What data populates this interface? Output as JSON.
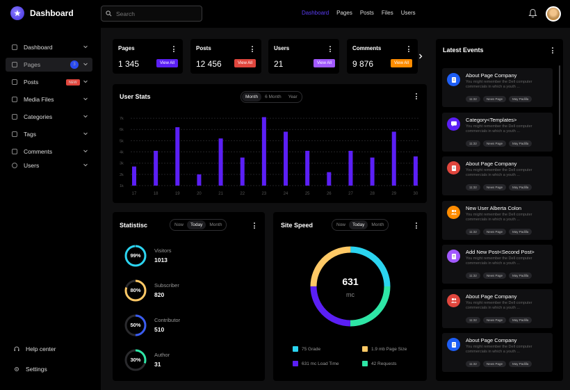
{
  "app": {
    "title": "Dashboard"
  },
  "search": {
    "placeholder": "Search"
  },
  "topnav": [
    {
      "label": "Dashboard",
      "active": true
    },
    {
      "label": "Pages"
    },
    {
      "label": "Posts"
    },
    {
      "label": "Files"
    },
    {
      "label": "Users"
    }
  ],
  "sidebar": {
    "items": [
      {
        "label": "Dashboard"
      },
      {
        "label": "Pages",
        "badge": "3"
      },
      {
        "label": "Posts",
        "badge": "NEW"
      },
      {
        "label": "Media Files"
      },
      {
        "label": "Categories"
      },
      {
        "label": "Tags"
      },
      {
        "label": "Comments"
      },
      {
        "label": "Users"
      }
    ],
    "help": "Help center",
    "settings": "Settings"
  },
  "stats": [
    {
      "label": "Pages",
      "value": "1 345",
      "button": "View All",
      "color": "#5b1ff5"
    },
    {
      "label": "Posts",
      "value": "12 456",
      "button": "View All",
      "color": "#e0463d"
    },
    {
      "label": "Users",
      "value": "21",
      "button": "View All",
      "color": "#a259ff"
    },
    {
      "label": "Comments",
      "value": "9 876",
      "button": "View All",
      "color": "#ff8c00"
    }
  ],
  "user_stats": {
    "title": "User Stats",
    "tabs": [
      "Month",
      "6 Month",
      "Year"
    ]
  },
  "chart_data": {
    "type": "bar",
    "categories": [
      "17",
      "18",
      "19",
      "20",
      "21",
      "22",
      "23",
      "24",
      "25",
      "26",
      "27",
      "28",
      "29",
      "30"
    ],
    "values": [
      2.7,
      4.1,
      6.2,
      2.0,
      5.2,
      3.5,
      7.1,
      5.8,
      4.1,
      2.2,
      4.1,
      3.5,
      5.8,
      3.6
    ],
    "y_ticks": [
      "1k",
      "2k",
      "3k",
      "4k",
      "5k",
      "6k",
      "7k"
    ],
    "ylim": [
      1,
      7.5
    ],
    "color": "#5b1ff5",
    "grid": true
  },
  "statistic": {
    "title": "Statistisc",
    "tabs": [
      "Now",
      "Today",
      "Month"
    ],
    "rows": [
      {
        "pct": "99%",
        "percent": 99,
        "name": "Visitors",
        "value": "1013",
        "color": "#2bd4f0"
      },
      {
        "pct": "80%",
        "percent": 80,
        "name": "Subscriber",
        "value": "820",
        "color": "#ffc966"
      },
      {
        "pct": "50%",
        "percent": 50,
        "name": "Contributor",
        "value": "510",
        "color": "#3a5cf0"
      },
      {
        "pct": "30%",
        "percent": 30,
        "name": "Author",
        "value": "31",
        "color": "#2ee6a6"
      }
    ]
  },
  "site_speed": {
    "title": "Site Speed",
    "tabs": [
      "Now",
      "Today",
      "Month"
    ],
    "value": "631",
    "unit": "mc",
    "legend": [
      {
        "label": "75 Grade",
        "color": "#2bd4f0"
      },
      {
        "label": "1.9 mb Page Size",
        "color": "#ffc966"
      },
      {
        "label": "631 mc Load Time",
        "color": "#5b1ff5"
      },
      {
        "label": "42 Requests",
        "color": "#2ee6a6"
      }
    ]
  },
  "events": {
    "title": "Latest Events",
    "items": [
      {
        "title": "About Page Company",
        "desc": "You might remember the Dell computer commercials in which a youth ...",
        "tags": [
          "11:32",
          "News Page",
          "May Padilla"
        ],
        "color": "#1e5ef5",
        "icon": "page-icon"
      },
      {
        "title": "Category<Templates>",
        "desc": "You might remember the Dell computer commercials in which a youth ...",
        "tags": [
          "11:32",
          "News Page",
          "May Padilla"
        ],
        "color": "#5b1ff5",
        "icon": "chat-icon"
      },
      {
        "title": "About Page Company",
        "desc": "You might remember the Dell computer commercials in which a youth ...",
        "tags": [
          "11:32",
          "News Page",
          "May Padilla"
        ],
        "color": "#e0463d",
        "icon": "page-icon"
      },
      {
        "title": "New User Alberta Colon",
        "desc": "You might remember the Dell computer commercials in which a youth ...",
        "tags": [
          "11:32",
          "News Page",
          "May Padilla"
        ],
        "color": "#ff8c00",
        "icon": "users-icon"
      },
      {
        "title": "Add New Post<Second Post>",
        "desc": "You might remember the Dell computer commercials in which a youth ...",
        "tags": [
          "11:32",
          "News Page",
          "May Padilla"
        ],
        "color": "#a259ff",
        "icon": "page-icon"
      },
      {
        "title": "About Page Company",
        "desc": "You might remember the Dell computer commercials in which a youth ...",
        "tags": [
          "11:32",
          "News Page",
          "May Padilla"
        ],
        "color": "#e0463d",
        "icon": "users-icon"
      },
      {
        "title": "About Page Company",
        "desc": "You might remember the Dell computer commercials in which a youth ...",
        "tags": [
          "11:32",
          "News Page",
          "May Padilla"
        ],
        "color": "#1e5ef5",
        "icon": "page-icon"
      }
    ]
  }
}
